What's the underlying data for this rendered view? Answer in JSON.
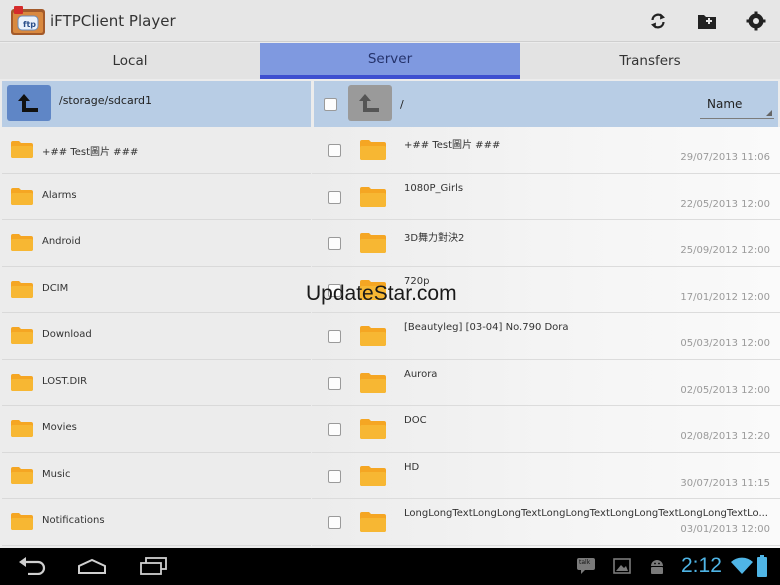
{
  "app": {
    "title": "iFTPClient Player",
    "icon_label": "ftp"
  },
  "actions": [
    {
      "name": "refresh-icon"
    },
    {
      "name": "new-folder-icon"
    },
    {
      "name": "settings-icon"
    }
  ],
  "tabs": [
    {
      "label": "Local",
      "active": false
    },
    {
      "label": "Server",
      "active": true
    },
    {
      "label": "Transfers",
      "active": false
    }
  ],
  "local": {
    "path": "/storage/sdcard1",
    "items": [
      {
        "name": "+## Test圖片 ###"
      },
      {
        "name": "Alarms"
      },
      {
        "name": "Android"
      },
      {
        "name": "DCIM"
      },
      {
        "name": "Download"
      },
      {
        "name": "LOST.DIR"
      },
      {
        "name": "Movies"
      },
      {
        "name": "Music"
      },
      {
        "name": "Notifications"
      }
    ]
  },
  "server": {
    "path": "/",
    "sort_label": "Name",
    "items": [
      {
        "name": "+## Test圖片 ###",
        "date": "29/07/2013 11:06"
      },
      {
        "name": "1080P_Girls",
        "date": "22/05/2013 12:00"
      },
      {
        "name": "3D舞力對決2",
        "date": "25/09/2012 12:00"
      },
      {
        "name": "720p",
        "date": "17/01/2012 12:00"
      },
      {
        "name": "[Beautyleg] [03-04] No.790 Dora",
        "date": "05/03/2013 12:00"
      },
      {
        "name": "Aurora",
        "date": "02/05/2013 12:00"
      },
      {
        "name": "DOC",
        "date": "02/08/2013 12:20"
      },
      {
        "name": "HD",
        "date": "30/07/2013 11:15"
      },
      {
        "name": "LongLongTextLongLongTextLongLongTextLongLongTextLongLongTextLo...",
        "date": "03/01/2013 12:00"
      }
    ]
  },
  "watermark": "UpdateStar.com",
  "statusbar": {
    "time": "2:12",
    "talk_label": "talk"
  },
  "colors": {
    "tab_active": "#7f99e0",
    "tab_indicator": "#3d4fd0",
    "path_bar": "#b8cde5",
    "folder": "#f5a623",
    "clock": "#4fb5e6"
  }
}
